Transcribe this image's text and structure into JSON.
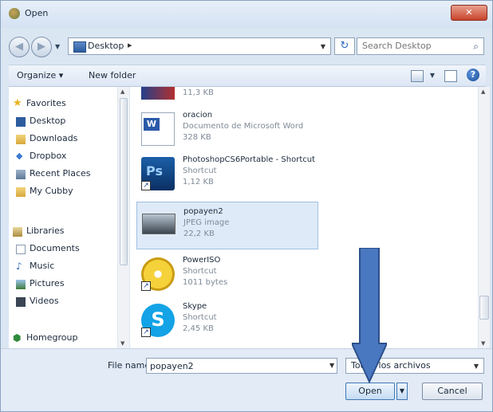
{
  "window": {
    "title": "Open"
  },
  "navbar": {
    "address_path": "Desktop",
    "search_placeholder": "Search Desktop"
  },
  "commandbar": {
    "organize": "Organize ▾",
    "new_folder": "New folder"
  },
  "sidebar": {
    "items": [
      {
        "label": "Favorites",
        "icon": "star-icon",
        "group": true
      },
      {
        "label": "Desktop",
        "icon": "desktop-icon",
        "group": false
      },
      {
        "label": "Downloads",
        "icon": "downloads-folder-icon",
        "group": false
      },
      {
        "label": "Dropbox",
        "icon": "dropbox-icon",
        "group": false
      },
      {
        "label": "Recent Places",
        "icon": "recent-places-icon",
        "group": false
      },
      {
        "label": "My Cubby",
        "icon": "folder-icon",
        "group": false
      },
      {
        "label": "Libraries",
        "icon": "libraries-icon",
        "group": true
      },
      {
        "label": "Documents",
        "icon": "documents-icon",
        "group": false
      },
      {
        "label": "Music",
        "icon": "music-icon",
        "group": false
      },
      {
        "label": "Pictures",
        "icon": "pictures-icon",
        "group": false
      },
      {
        "label": "Videos",
        "icon": "videos-icon",
        "group": false
      },
      {
        "label": "Homegroup",
        "icon": "homegroup-icon",
        "group": true
      }
    ]
  },
  "files": [
    {
      "name": "",
      "type": "",
      "size": "11,3 KB",
      "icon": "image-thumbnail-icon",
      "selected": false
    },
    {
      "name": "oracion",
      "type": "Documento de Microsoft Word",
      "size": "328 KB",
      "icon": "word-document-icon",
      "selected": false
    },
    {
      "name": "PhotoshopCS6Portable - Shortcut",
      "type": "Shortcut",
      "size": "1,12 KB",
      "icon": "photoshop-icon",
      "selected": false
    },
    {
      "name": "popayen2",
      "type": "JPEG image",
      "size": "22,2 KB",
      "icon": "jpeg-thumbnail-icon",
      "selected": true
    },
    {
      "name": "PowerISO",
      "type": "Shortcut",
      "size": "1011 bytes",
      "icon": "poweriso-icon",
      "selected": false
    },
    {
      "name": "Skype",
      "type": "Shortcut",
      "size": "2,45 KB",
      "icon": "skype-icon",
      "selected": false
    }
  ],
  "footer": {
    "filename_label": "File name:",
    "filename_value": "popayen2",
    "filetype_value": "Todos los archivos",
    "open_label": "Open",
    "cancel_label": "Cancel"
  },
  "colors": {
    "arrow": "#4a78c0",
    "selection": "#dfeaf8",
    "accent": "#2c6bc0"
  }
}
